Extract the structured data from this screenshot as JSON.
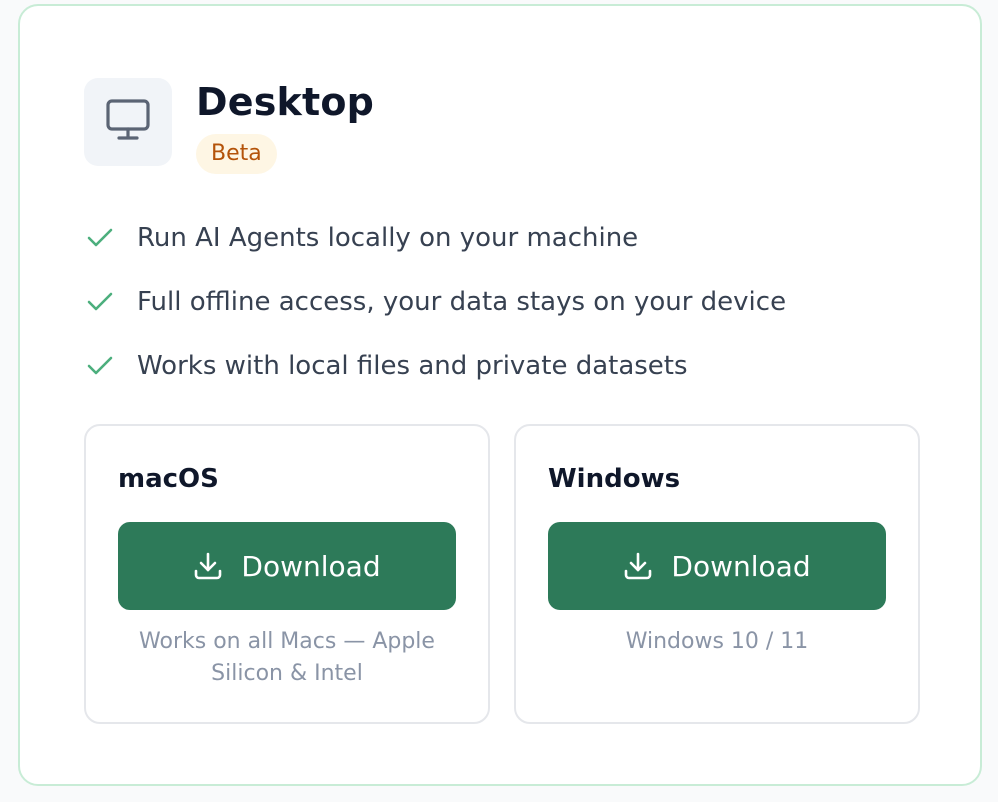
{
  "card": {
    "title": "Desktop",
    "badge": "Beta",
    "icon": "monitor-icon",
    "accent_color": "#2d7a59",
    "badge_color": "#b45309",
    "check_color": "#4caf7d"
  },
  "features": [
    {
      "icon": "check-icon",
      "text": "Run AI Agents locally on your machine"
    },
    {
      "icon": "check-icon",
      "text": "Full offline access, your data stays on your device"
    },
    {
      "icon": "check-icon",
      "text": "Works with local files and private datasets"
    }
  ],
  "platforms": [
    {
      "name": "macOS",
      "button_icon": "download-icon",
      "button_label": "Download",
      "note": "Works on all Macs — Apple Silicon & Intel"
    },
    {
      "name": "Windows",
      "button_icon": "download-icon",
      "button_label": "Download",
      "note": "Windows 10 / 11"
    }
  ]
}
